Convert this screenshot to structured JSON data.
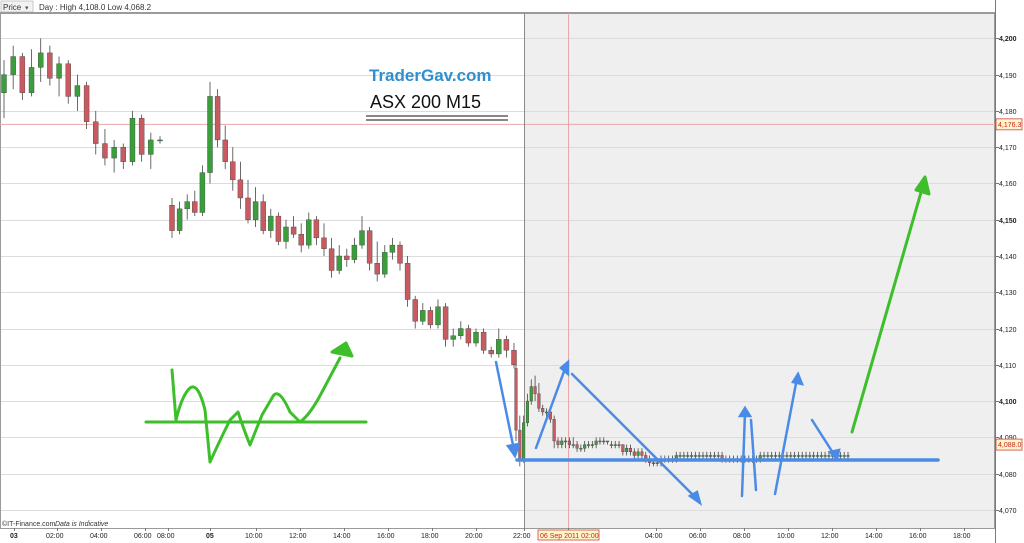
{
  "header": {
    "menu_label": "Price",
    "info_text": "Day : High 4,108.0 Low 4,068.2"
  },
  "footer": {
    "copyright": "©IT-Finance.com",
    "disclaimer": "Data is Indicative"
  },
  "annotations": {
    "brand": "TraderGav.com",
    "subtitle": "ASX 200 M15"
  },
  "colors": {
    "up_candle": "#3a9e3a",
    "down_candle": "#c95a62",
    "grid": "#dcdcdc",
    "shaded_session": "#efefef",
    "blue_arrow": "#4a8be8",
    "green_drawing": "#3cbf2a",
    "brand_text": "#2f8fcf"
  },
  "chart_data": {
    "type": "candlestick",
    "title": "",
    "ylim": [
      4065,
      4207
    ],
    "y_ticks": [
      "4,070",
      "4,080",
      "4,090",
      "4,100",
      "4,110",
      "4,120",
      "4,130",
      "4,140",
      "4,150",
      "4,160",
      "4,170",
      "4,180",
      "4,190",
      "4,200"
    ],
    "x_ticks": [
      "03",
      "02:00",
      "04:00",
      "06:00",
      "08:00",
      "05",
      "10:00",
      "12:00",
      "14:00",
      "16:00",
      "18:00",
      "20:00",
      "22:00",
      "06",
      "06 Sep 2011 02:00",
      "04:00",
      "06:00",
      "08:00",
      "10:00",
      "12:00",
      "14:00",
      "16:00",
      "18:00",
      "20:00"
    ],
    "markers": {
      "horizontal_price": 4176.3,
      "horizontal_label": "4,176.3",
      "last_price": 4088.0,
      "last_label": "4,088.0",
      "vertical_time_label": "06 Sep 2011 02:00"
    },
    "series": [
      {
        "name": "",
        "segment": 1,
        "ohlc": [
          [
            4185,
            4194,
            4178,
            4190
          ],
          [
            4190,
            4198,
            4186,
            4195
          ],
          [
            4195,
            4196,
            4183,
            4185
          ],
          [
            4185,
            4197,
            4184,
            4192
          ],
          [
            4192,
            4200,
            4188,
            4196
          ],
          [
            4196,
            4198,
            4187,
            4189
          ],
          [
            4189,
            4195,
            4184,
            4193
          ],
          [
            4193,
            4194,
            4182,
            4184
          ],
          [
            4184,
            4190,
            4180,
            4187
          ],
          [
            4187,
            4188,
            4175,
            4177
          ],
          [
            4177,
            4180,
            4168,
            4171
          ],
          [
            4171,
            4175,
            4165,
            4167
          ],
          [
            4167,
            4172,
            4163,
            4170
          ],
          [
            4170,
            4171,
            4164,
            4166
          ],
          [
            4166,
            4180,
            4165,
            4178
          ],
          [
            4178,
            4179,
            4166,
            4168
          ],
          [
            4168,
            4174,
            4164,
            4172
          ],
          [
            4172,
            4173,
            4171,
            4172
          ]
        ]
      },
      {
        "name": "",
        "segment": 2,
        "ohlc": [
          [
            4154,
            4156,
            4145,
            4147
          ],
          [
            4147,
            4155,
            4146,
            4153
          ],
          [
            4153,
            4157,
            4150,
            4155
          ],
          [
            4155,
            4158,
            4151,
            4152
          ],
          [
            4152,
            4165,
            4151,
            4163
          ],
          [
            4163,
            4188,
            4160,
            4184
          ],
          [
            4184,
            4186,
            4170,
            4172
          ],
          [
            4172,
            4176,
            4164,
            4166
          ],
          [
            4166,
            4170,
            4158,
            4161
          ],
          [
            4161,
            4166,
            4153,
            4156
          ],
          [
            4156,
            4161,
            4149,
            4150
          ],
          [
            4150,
            4159,
            4148,
            4155
          ],
          [
            4155,
            4157,
            4146,
            4147
          ],
          [
            4147,
            4153,
            4145,
            4151
          ],
          [
            4151,
            4152,
            4143,
            4144
          ],
          [
            4144,
            4150,
            4142,
            4148
          ],
          [
            4148,
            4151,
            4145,
            4146
          ],
          [
            4146,
            4149,
            4141,
            4143
          ],
          [
            4143,
            4152,
            4142,
            4150
          ],
          [
            4150,
            4151,
            4143,
            4145
          ],
          [
            4145,
            4149,
            4140,
            4142
          ],
          [
            4142,
            4145,
            4134,
            4136
          ],
          [
            4136,
            4143,
            4135,
            4140
          ],
          [
            4140,
            4142,
            4137,
            4139
          ],
          [
            4139,
            4145,
            4138,
            4143
          ],
          [
            4143,
            4151,
            4142,
            4147
          ],
          [
            4147,
            4148,
            4136,
            4138
          ],
          [
            4138,
            4144,
            4133,
            4135
          ],
          [
            4135,
            4143,
            4134,
            4141
          ],
          [
            4141,
            4145,
            4139,
            4143
          ],
          [
            4143,
            4144,
            4136,
            4138
          ],
          [
            4138,
            4140,
            4126,
            4128
          ],
          [
            4128,
            4129,
            4120,
            4122
          ],
          [
            4122,
            4127,
            4121,
            4125
          ],
          [
            4125,
            4126,
            4120,
            4121
          ],
          [
            4121,
            4128,
            4120,
            4126
          ],
          [
            4126,
            4127,
            4115,
            4117
          ],
          [
            4117,
            4120,
            4115,
            4118
          ],
          [
            4118,
            4122,
            4117,
            4120
          ],
          [
            4120,
            4121,
            4115,
            4116
          ],
          [
            4116,
            4120,
            4115,
            4119
          ],
          [
            4119,
            4120,
            4113,
            4114
          ],
          [
            4114,
            4115,
            4112,
            4113
          ],
          [
            4113,
            4120,
            4112,
            4117
          ],
          [
            4117,
            4118,
            4112,
            4114
          ],
          [
            4114,
            4116,
            4109,
            4110
          ]
        ]
      },
      {
        "name": "",
        "segment": 3,
        "ohlc": [
          [
            4109,
            4110,
            4089,
            4092
          ],
          [
            4092,
            4096,
            4082,
            4084
          ],
          [
            4084,
            4096,
            4083,
            4094
          ],
          [
            4094,
            4102,
            4093,
            4100
          ],
          [
            4100,
            4106,
            4099,
            4104
          ],
          [
            4104,
            4107,
            4100,
            4102
          ],
          [
            4102,
            4105,
            4097,
            4098
          ],
          [
            4098,
            4099,
            4096,
            4097
          ],
          [
            4097,
            4098,
            4095,
            4097
          ],
          [
            4097,
            4098,
            4094,
            4095
          ],
          [
            4095,
            4096,
            4087,
            4089
          ],
          [
            4089,
            4090,
            4087,
            4088
          ],
          [
            4088,
            4090,
            4087,
            4089
          ],
          [
            4089,
            4090,
            4087,
            4089
          ],
          [
            4089,
            4090,
            4087,
            4088
          ],
          [
            4088,
            4090,
            4087,
            4088
          ],
          [
            4088,
            4089,
            4086,
            4087
          ],
          [
            4087,
            4088,
            4086,
            4087
          ],
          [
            4087,
            4089,
            4086,
            4088
          ],
          [
            4088,
            4089,
            4087,
            4088
          ],
          [
            4088,
            4089,
            4087,
            4088
          ],
          [
            4088,
            4090,
            4087,
            4089
          ],
          [
            4089,
            4090,
            4088,
            4089
          ],
          [
            4089,
            4090,
            4088,
            4089
          ],
          [
            4089,
            4089,
            4088,
            4089
          ],
          [
            4088,
            4089,
            4087,
            4088
          ],
          [
            4088,
            4089,
            4087,
            4088
          ],
          [
            4088,
            4089,
            4087,
            4088
          ],
          [
            4088,
            4088,
            4085,
            4086
          ],
          [
            4086,
            4088,
            4085,
            4087
          ],
          [
            4087,
            4088,
            4085,
            4086
          ],
          [
            4086,
            4087,
            4084,
            4085
          ],
          [
            4085,
            4087,
            4084,
            4086
          ],
          [
            4086,
            4087,
            4084,
            4085
          ],
          [
            4085,
            4086,
            4083,
            4084
          ],
          [
            4084,
            4085,
            4082,
            4083
          ],
          [
            4083,
            4084,
            4082,
            4083
          ],
          [
            4083,
            4084,
            4082,
            4083
          ],
          [
            4083,
            4085,
            4082,
            4084
          ],
          [
            4084,
            4085,
            4083,
            4084
          ],
          [
            4084,
            4085,
            4083,
            4084
          ],
          [
            4084,
            4085,
            4083,
            4084
          ],
          [
            4084,
            4086,
            4083,
            4085
          ],
          [
            4085,
            4086,
            4084,
            4085
          ],
          [
            4085,
            4086,
            4084,
            4085
          ],
          [
            4085,
            4086,
            4084,
            4085
          ],
          [
            4085,
            4086,
            4084,
            4085
          ],
          [
            4085,
            4086,
            4084,
            4085
          ],
          [
            4085,
            4086,
            4084,
            4085
          ],
          [
            4085,
            4086,
            4084,
            4085
          ],
          [
            4085,
            4086,
            4084,
            4085
          ],
          [
            4085,
            4086,
            4084,
            4085
          ],
          [
            4085,
            4086,
            4084,
            4085
          ],
          [
            4085,
            4086,
            4084,
            4085
          ],
          [
            4085,
            4086,
            4083,
            4084
          ],
          [
            4084,
            4085,
            4083,
            4084
          ],
          [
            4084,
            4085,
            4083,
            4084
          ],
          [
            4084,
            4085,
            4083,
            4084
          ],
          [
            4084,
            4085,
            4083,
            4084
          ],
          [
            4084,
            4085,
            4083,
            4084
          ],
          [
            4084,
            4085,
            4083,
            4084
          ],
          [
            4084,
            4085,
            4083,
            4084
          ],
          [
            4084,
            4085,
            4083,
            4084
          ],
          [
            4084,
            4085,
            4083,
            4084
          ],
          [
            4084,
            4086,
            4083,
            4085
          ],
          [
            4085,
            4086,
            4084,
            4085
          ],
          [
            4085,
            4086,
            4084,
            4085
          ],
          [
            4085,
            4086,
            4084,
            4085
          ],
          [
            4085,
            4086,
            4084,
            4085
          ],
          [
            4085,
            4086,
            4084,
            4085
          ],
          [
            4085,
            4086,
            4084,
            4085
          ],
          [
            4085,
            4086,
            4084,
            4085
          ],
          [
            4085,
            4086,
            4084,
            4085
          ],
          [
            4085,
            4086,
            4084,
            4085
          ],
          [
            4085,
            4086,
            4084,
            4085
          ],
          [
            4085,
            4086,
            4084,
            4085
          ],
          [
            4085,
            4086,
            4084,
            4085
          ],
          [
            4085,
            4086,
            4084,
            4085
          ],
          [
            4085,
            4086,
            4084,
            4085
          ],
          [
            4085,
            4086,
            4084,
            4085
          ],
          [
            4085,
            4086,
            4084,
            4085
          ],
          [
            4085,
            4086,
            4084,
            4085
          ],
          [
            4085,
            4086,
            4084,
            4085
          ],
          [
            4085,
            4086,
            4084,
            4085
          ],
          [
            4085,
            4086,
            4084,
            4085
          ],
          [
            4085,
            4086,
            4084,
            4085
          ],
          [
            4085,
            4086,
            4084,
            4085
          ],
          [
            4085,
            4086,
            4084,
            4085
          ]
        ]
      }
    ]
  }
}
